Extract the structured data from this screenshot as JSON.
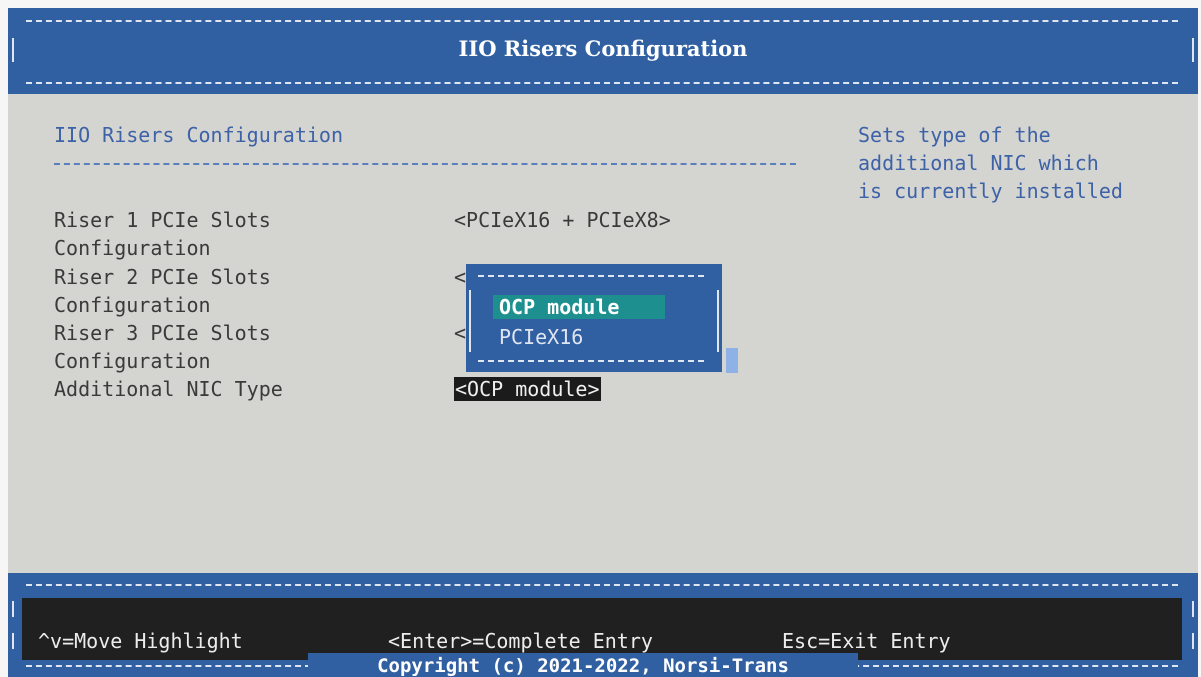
{
  "header": {
    "title": "IIO Risers Configuration"
  },
  "main": {
    "section_title": "IIO Risers Configuration",
    "help_lines": [
      "Sets type of the",
      "additional NIC which",
      "is currently installed"
    ],
    "settings": [
      {
        "label_line1": "Riser 1 PCIe Slots",
        "label_line2": "Configuration",
        "value": "<PCIeX16 + PCIeX8>"
      },
      {
        "label_line1": "Riser 2 PCIe Slots",
        "label_line2": "Configuration",
        "value_prefix": "<"
      },
      {
        "label_line1": "Riser 3 PCIe Slots",
        "label_line2": "Configuration",
        "value_prefix": "<"
      },
      {
        "label_line1": "Additional NIC Type",
        "value": "<OCP module>"
      }
    ]
  },
  "popup": {
    "options": [
      "OCP module",
      "PCIeX16"
    ],
    "selected": "OCP module"
  },
  "footer": {
    "keys": [
      "^v=Move Highlight",
      "<Enter>=Complete Entry",
      "Esc=Exit Entry"
    ],
    "copyright": "Copyright (c) 2021-2022, Norsi-Trans"
  }
}
